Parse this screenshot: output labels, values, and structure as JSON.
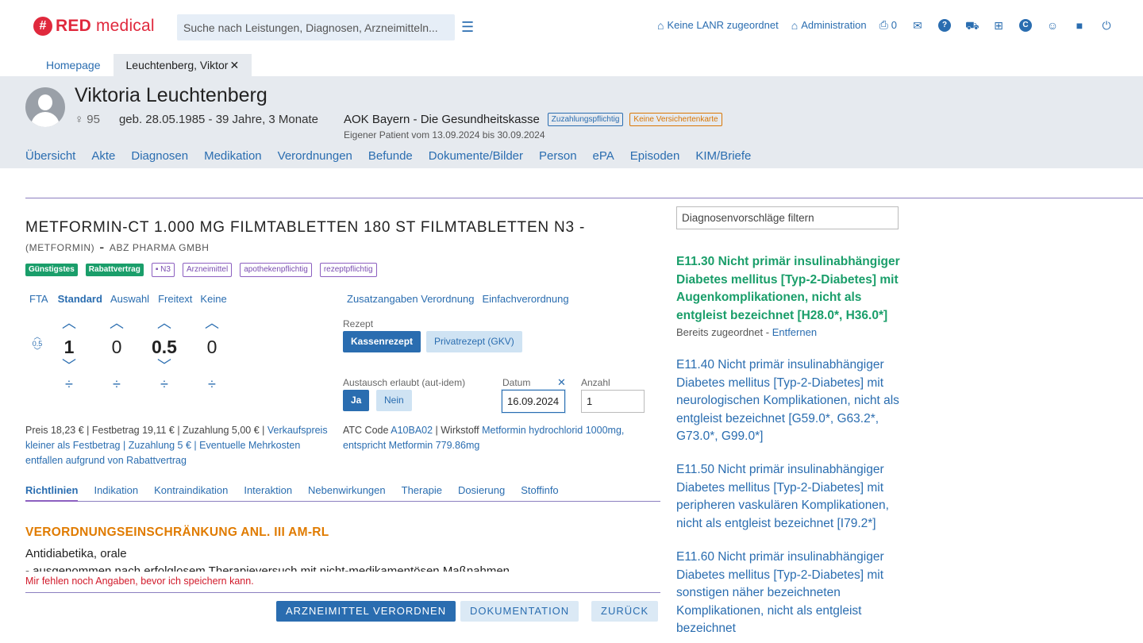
{
  "app": {
    "logo_mark": "#",
    "logo_bold": "RED",
    "logo_rest": " medical",
    "search_placeholder": "Suche nach Leistungen, Diagnosen, Arzneimitteln...",
    "top_links": {
      "lanr": "Keine LANR zugeordnet",
      "admin": "Administration",
      "print_count": "0"
    }
  },
  "tabs": [
    {
      "label": "Homepage"
    },
    {
      "label": "Leuchtenberg, Viktor",
      "close": "✕"
    }
  ],
  "patient": {
    "name": "Viktoria Leuchtenberg",
    "gender_symbol": "♀",
    "age_number": "95",
    "birth": "geb. 28.05.1985 - 39 Jahre, 3 Monate",
    "insurance": "AOK Bayern - Die Gesundheitskasse",
    "badge_copay": "Zuzahlungspflichtig",
    "badge_card": "Keine Versichertenkarte",
    "own_patient": "Eigener Patient vom 13.09.2024 bis 30.09.2024",
    "nav": [
      "Übersicht",
      "Akte",
      "Diagnosen",
      "Medikation",
      "Verordnungen",
      "Befunde",
      "Dokumente/Bilder",
      "Person",
      "ePA",
      "Episoden",
      "KIM/Briefe"
    ]
  },
  "drug": {
    "title": "METFORMIN-CT 1.000 MG FILMTABLETTEN 180 ST FILMTABLETTEN N3 -",
    "ingredient": "(METFORMIN)",
    "dash": "-",
    "manufacturer": "ABZ PHARMA GMBH",
    "chips": [
      "Günstigstes",
      "Rabattvertrag",
      "N3",
      "Arzneimittel",
      "apothekenpflichtig",
      "rezeptpflichtig"
    ]
  },
  "dosage": {
    "modes": [
      "FTA",
      "Standard",
      "Auswahl",
      "Freitext",
      "Keine"
    ],
    "step": "0.5",
    "values": [
      "1",
      "0",
      "0.5",
      "0"
    ],
    "divider": "÷"
  },
  "prescription": {
    "links": [
      "Zusatzangaben Verordnung",
      "Einfachverordnung"
    ],
    "rezept_label": "Rezept",
    "kassen_label": "Kassenrezept",
    "privat_label": "Privatrezept (GKV)",
    "autidem_label": "Austausch erlaubt (aut-idem)",
    "ja_label": "Ja",
    "nein_label": "Nein",
    "datum_label": "Datum",
    "datum_value": "16.09.2024",
    "clear": "✕",
    "anzahl_label": "Anzahl",
    "anzahl_value": "1"
  },
  "price": {
    "plain": "Preis 18,23 € | Festbetrag 19,11 € | Zuzahlung 5,00 € |",
    "link": " Verkaufspreis kleiner als Festbetrag | Zuzahlung 5 € | Eventuelle Mehrkosten entfallen aufgrund von Rabattvertrag"
  },
  "atc": {
    "prefix": "ATC Code",
    "code": "A10BA02",
    "mid": " | Wirkstoff ",
    "substance": "Metformin hydrochlorid 1000mg, entspricht Metformin 779.86mg"
  },
  "info_tabs": [
    "Richtlinien",
    "Indikation",
    "Kontraindikation",
    "Interaktion",
    "Nebenwirkungen",
    "Therapie",
    "Dosierung",
    "Stoffinfo"
  ],
  "guideline": {
    "title": "VERORDNUNGSEINSCHRÄNKUNG ANL. III AM-RL",
    "line1": "Antidiabetika, orale",
    "line2": "- ausgenommen nach erfolglosem Therapieversuch mit nicht-medikamentösen Maßnahmen"
  },
  "warning": "Mir fehlen noch Angaben, bevor ich speichern kann.",
  "actions": {
    "prescribe": "ARZNEIMITTEL VERORDNEN",
    "docs": "DOKUMENTATION",
    "back": "ZURÜCK"
  },
  "diagnoses": {
    "filter_placeholder": "Diagnosenvorschläge filtern",
    "items": [
      "E11.30 Nicht primär insulinabhängiger Diabetes mellitus [Typ-2-Diabetes] mit Augenkomplikationen, nicht als entgleist bezeichnet [H28.0*, H36.0*]",
      "E11.40 Nicht primär insulinabhängiger Diabetes mellitus [Typ-2-Diabetes] mit neurologischen Komplikationen, nicht als entgleist bezeichnet [G59.0*, G63.2*, G73.0*, G99.0*]",
      "E11.50 Nicht primär insulinabhängiger Diabetes mellitus [Typ-2-Diabetes] mit peripheren vaskulären Komplikationen, nicht als entgleist bezeichnet [I79.2*]",
      "E11.60 Nicht primär insulinabhängiger Diabetes mellitus [Typ-2-Diabetes] mit sonstigen näher bezeichneten Komplikationen, nicht als entgleist bezeichnet"
    ],
    "assigned_note": "Bereits zugeordnet - ",
    "remove_link": "Entfernen"
  },
  "colors": {
    "accent": "#2a6db0",
    "brand": "#e0293d",
    "success": "#1a9e6a",
    "warning": "#e07b00",
    "error": "#d11a2a"
  }
}
